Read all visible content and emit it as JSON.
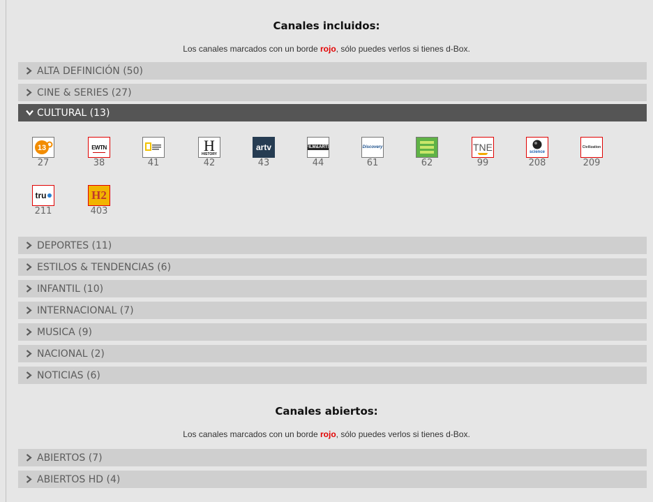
{
  "included": {
    "heading": "Canales incluidos:",
    "note_before": "Los canales marcados con un borde ",
    "note_red": "rojo",
    "note_after": ", sólo puedes verlos si tienes d-Box.",
    "categories": [
      {
        "label": "ALTA DEFINICIÓN (50)",
        "open": false
      },
      {
        "label": "CINE & SERIES (27)",
        "open": false
      },
      {
        "label": "CULTURAL (13)",
        "open": true
      },
      {
        "label": "DEPORTES (11)",
        "open": false
      },
      {
        "label": "ESTILOS & TENDENCIAS (6)",
        "open": false
      },
      {
        "label": "INFANTIL (10)",
        "open": false
      },
      {
        "label": "INTERNACIONAL (7)",
        "open": false
      },
      {
        "label": "MUSICA (9)",
        "open": false
      },
      {
        "label": "NACIONAL (2)",
        "open": false
      },
      {
        "label": "NOTICIAS (6)",
        "open": false
      }
    ],
    "cultural_channels": [
      {
        "number": "27",
        "logo": "13c-logo",
        "red_border": false
      },
      {
        "number": "38",
        "logo": "ewtn-logo",
        "red_border": true
      },
      {
        "number": "41",
        "logo": "national-geographic-logo",
        "red_border": false
      },
      {
        "number": "42",
        "logo": "history-logo",
        "red_border": false
      },
      {
        "number": "43",
        "logo": "artv-logo",
        "red_border": false
      },
      {
        "number": "44",
        "logo": "film-arts-logo",
        "red_border": false
      },
      {
        "number": "61",
        "logo": "discovery-logo",
        "red_border": false
      },
      {
        "number": "62",
        "logo": "animal-planet-logo",
        "red_border": false
      },
      {
        "number": "99",
        "logo": "tne-logo",
        "red_border": true
      },
      {
        "number": "208",
        "logo": "science-logo",
        "red_border": true
      },
      {
        "number": "209",
        "logo": "discovery-civilization-logo",
        "red_border": true
      },
      {
        "number": "211",
        "logo": "tru-tv-logo",
        "red_border": true
      },
      {
        "number": "403",
        "logo": "h2-logo",
        "red_border": true
      }
    ]
  },
  "open": {
    "heading": "Canales abiertos:",
    "note_before": "Los canales marcados con un borde ",
    "note_red": "rojo",
    "note_after": ", sólo puedes verlos si tienes d-Box.",
    "categories": [
      {
        "label": "ABIERTOS (7)"
      },
      {
        "label": "ABIERTOS HD (4)"
      }
    ]
  },
  "logo_text": {
    "13c": "13",
    "ewtn": "EWTN",
    "history": "HISTORY",
    "artv": "artv",
    "filmarts": "FILM&ARTS",
    "discovery": "Discovery",
    "tne": "TNE",
    "science": "science",
    "civilization": "Civilization",
    "tru": "tru",
    "h2": "H2"
  },
  "colors": {
    "accent_red": "#e20000",
    "panel_bg": "#e6e6e6",
    "category_bar": "#cfcfcf",
    "category_open": "#555555"
  }
}
